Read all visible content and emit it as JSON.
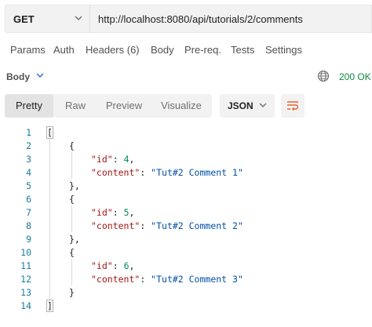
{
  "request": {
    "method": "GET",
    "url": "http://localhost:8080/api/tutorials/2/comments"
  },
  "request_tabs": [
    "Params",
    "Auth",
    "Headers (6)",
    "Body",
    "Pre-req.",
    "Tests",
    "Settings"
  ],
  "response": {
    "section_label": "Body",
    "status": "200 OK",
    "view_tabs": [
      "Pretty",
      "Raw",
      "Preview",
      "Visualize"
    ],
    "active_view": "Pretty",
    "format": "JSON"
  },
  "code": {
    "line_numbers": [
      "1",
      "2",
      "3",
      "4",
      "5",
      "6",
      "7",
      "8",
      "9",
      "10",
      "11",
      "12",
      "13",
      "14"
    ],
    "items": [
      {
        "id": "4",
        "content": "\"Tut#2 Comment 1\""
      },
      {
        "id": "5",
        "content": "\"Tut#2 Comment 2\""
      },
      {
        "id": "6",
        "content": "\"Tut#2 Comment 3\""
      }
    ],
    "key_id": "\"id\"",
    "key_content": "\"content\"",
    "open_array": "[",
    "close_array": "]",
    "open_obj": "{",
    "close_obj": "}",
    "close_obj_comma": "},"
  },
  "icons": {
    "method_dropdown": "chevron-down-icon",
    "body_dropdown": "chevron-down-icon",
    "network": "globe-icon",
    "format_dropdown": "chevron-down-icon",
    "wrap": "wrap-lines-icon"
  },
  "colors": {
    "status_ok": "#0c8a3f",
    "wrap_icon": "#e8632d",
    "json_key": "#a31515",
    "json_string": "#0451a5",
    "json_number": "#098658",
    "line_number": "#1a7a9f"
  }
}
